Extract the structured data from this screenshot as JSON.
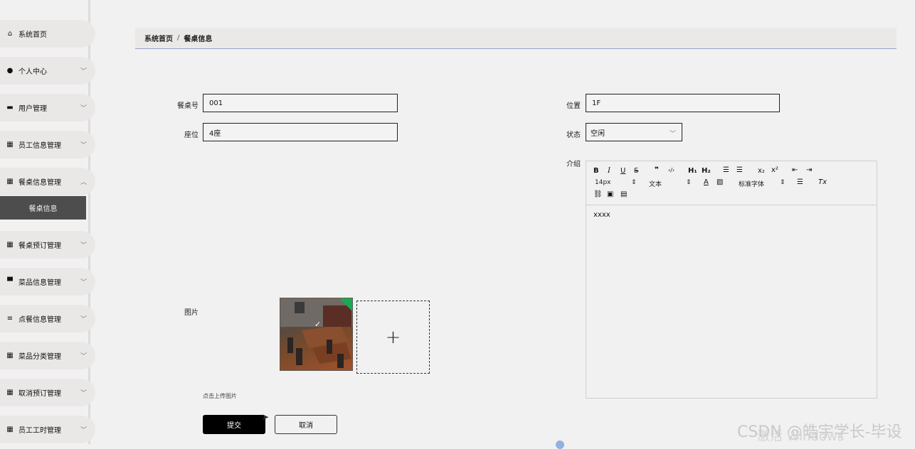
{
  "sidebar": {
    "items": [
      {
        "label": "系统首页",
        "icon": "home-icon",
        "glyph": "⌂",
        "chevron": ""
      },
      {
        "label": "个人中心",
        "icon": "user-icon",
        "glyph": "●",
        "chevron": "﹀"
      },
      {
        "label": "用户管理",
        "icon": "ticket-icon",
        "glyph": "▬",
        "chevron": "﹀"
      },
      {
        "label": "员工信息管理",
        "icon": "grid-icon",
        "glyph": "▦",
        "chevron": "﹀"
      },
      {
        "label": "餐桌信息管理",
        "icon": "grid-icon",
        "glyph": "▦",
        "chevron": "︿"
      },
      {
        "label": "餐桌预订管理",
        "icon": "grid-icon",
        "glyph": "▦",
        "chevron": "﹀"
      },
      {
        "label": "菜品信息管理",
        "icon": "tray-icon",
        "glyph": "▀",
        "chevron": "﹀"
      },
      {
        "label": "点餐信息管理",
        "icon": "list-icon",
        "glyph": "≡",
        "chevron": "﹀"
      },
      {
        "label": "菜品分类管理",
        "icon": "grid-icon",
        "glyph": "▦",
        "chevron": "﹀"
      },
      {
        "label": "取消预订管理",
        "icon": "grid-icon",
        "glyph": "▦",
        "chevron": "﹀"
      },
      {
        "label": "员工工时管理",
        "icon": "grid-icon",
        "glyph": "▦",
        "chevron": "﹀"
      }
    ],
    "active_sub": "餐桌信息"
  },
  "breadcrumb": {
    "home": "系统首页",
    "sep": "/",
    "current": "餐桌信息"
  },
  "form": {
    "table_no": {
      "label": "餐桌号",
      "value": "001"
    },
    "location": {
      "label": "位置",
      "value": "1F"
    },
    "seats": {
      "label": "座位",
      "value": "4座"
    },
    "status": {
      "label": "状态",
      "value": "空闲"
    },
    "intro": {
      "label": "介绍",
      "content": "xxxx"
    },
    "image": {
      "label": "图片",
      "hint": "点击上传图片",
      "add": "+",
      "check": "✓"
    }
  },
  "editor": {
    "font_size": "14px",
    "heading": "文本",
    "font_family": "标准字体"
  },
  "buttons": {
    "submit": "提交",
    "cancel": "取消"
  },
  "watermark": {
    "line1": "CSDN @皓宇学长-毕设",
    "line2": "激活 Windows"
  }
}
